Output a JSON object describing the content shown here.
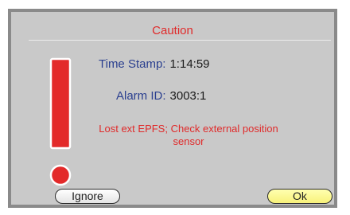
{
  "dialog": {
    "title": "Caution",
    "time_stamp": {
      "label": "Time Stamp:",
      "value": "1:14:59"
    },
    "alarm_id": {
      "label": "Alarm ID:",
      "value": "3003:1"
    },
    "message": "Lost ext EPFS; Check external position sensor",
    "icon": "exclamation-icon",
    "buttons": {
      "ignore": "Ignore",
      "ok": "Ok"
    }
  },
  "colors": {
    "accent_red": "#e02a2a",
    "label_blue": "#2a3f8f",
    "panel_gray": "#c9c9c9",
    "ok_yellow": "#f8f27a"
  }
}
